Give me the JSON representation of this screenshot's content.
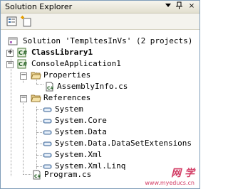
{
  "window": {
    "title": "Solution Explorer",
    "pin_glyph": "▪",
    "menu_glyph": "ᵩ",
    "close_glyph": "×"
  },
  "tree": {
    "solution": "Solution 'TempltesInVs' (2 projects)",
    "class_library": "ClassLibrary1",
    "console_app": "ConsoleApplication1",
    "properties": "Properties",
    "assembly_info": "AssemblyInfo.cs",
    "references": "References",
    "refs": [
      "System",
      "System.Core",
      "System.Data",
      "System.Data.DataSetExtensions",
      "System.Xml",
      "System.Xml.Linq"
    ],
    "program": "Program.cs"
  },
  "expanders": {
    "class_library": "+",
    "console_app": "−",
    "properties": "−",
    "references": "−"
  },
  "watermark": {
    "brand": "网 学",
    "url": "www.myeducs.cn"
  }
}
